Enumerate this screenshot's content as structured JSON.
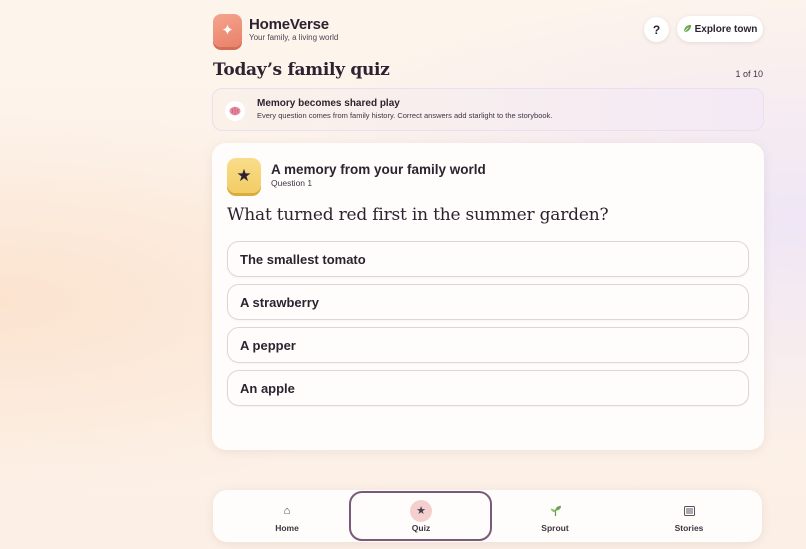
{
  "header": {
    "app_name": "HomeVerse",
    "tagline": "Your family, a living world",
    "logo_icon": "sparkle-icon",
    "help_label": "?",
    "explore_label": "Explore town",
    "explore_icon": "leaf-icon"
  },
  "page": {
    "title": "Today’s family quiz",
    "progress": "1 of 10"
  },
  "banner": {
    "icon": "brain-icon",
    "title": "Memory becomes shared play",
    "description": "Every question comes from family history. Correct answers add starlight to the storybook."
  },
  "quiz": {
    "icon": "star-icon",
    "heading": "A memory from your family world",
    "subheading": "Question 1",
    "question": "What turned red first in the summer garden?",
    "answers": [
      "The smallest tomato",
      "A strawberry",
      "A pepper",
      "An apple"
    ]
  },
  "nav": {
    "active": "Quiz",
    "items": [
      {
        "label": "Home",
        "icon": "home-icon"
      },
      {
        "label": "Quiz",
        "icon": "star-icon"
      },
      {
        "label": "Sprout",
        "icon": "sprout-icon"
      },
      {
        "label": "Stories",
        "icon": "book-icon"
      }
    ]
  },
  "colors": {
    "logo": "#ef8f77",
    "quiz_icon": "#f5d274",
    "active_ring": "#7a5a78",
    "text": "#2b2430"
  }
}
